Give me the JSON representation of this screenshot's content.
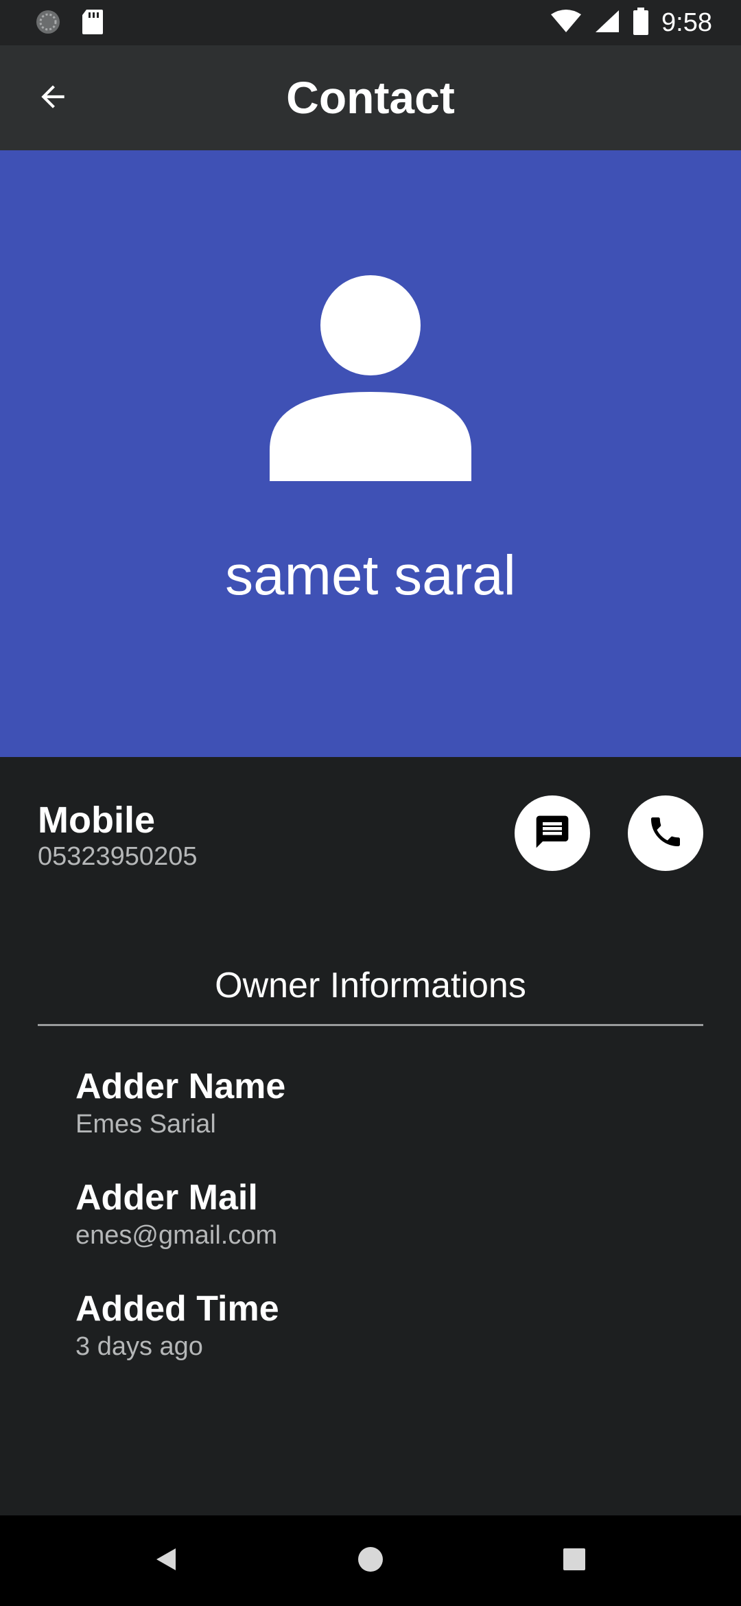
{
  "status_bar": {
    "time": "9:58",
    "icons": [
      "sync-icon",
      "sd-card-icon",
      "wifi-icon",
      "signal-icon",
      "battery-icon"
    ]
  },
  "app_bar": {
    "title": "Contact",
    "back_icon": "arrow-back-icon"
  },
  "hero": {
    "background_color": "#3f51b5",
    "avatar_icon": "person-icon",
    "name": "samet saral"
  },
  "mobile": {
    "label": "Mobile",
    "number": "05323950205",
    "message_icon": "message-icon",
    "call_icon": "phone-icon"
  },
  "owner": {
    "title": "Owner Informations",
    "items": [
      {
        "label": "Adder Name",
        "value": "Emes Sarial"
      },
      {
        "label": "Adder Mail",
        "value": "enes@gmail.com"
      },
      {
        "label": "Added Time",
        "value": "3 days ago"
      }
    ]
  },
  "nav_bar": {
    "icons": [
      "nav-back-icon",
      "nav-home-icon",
      "nav-recents-icon"
    ]
  }
}
